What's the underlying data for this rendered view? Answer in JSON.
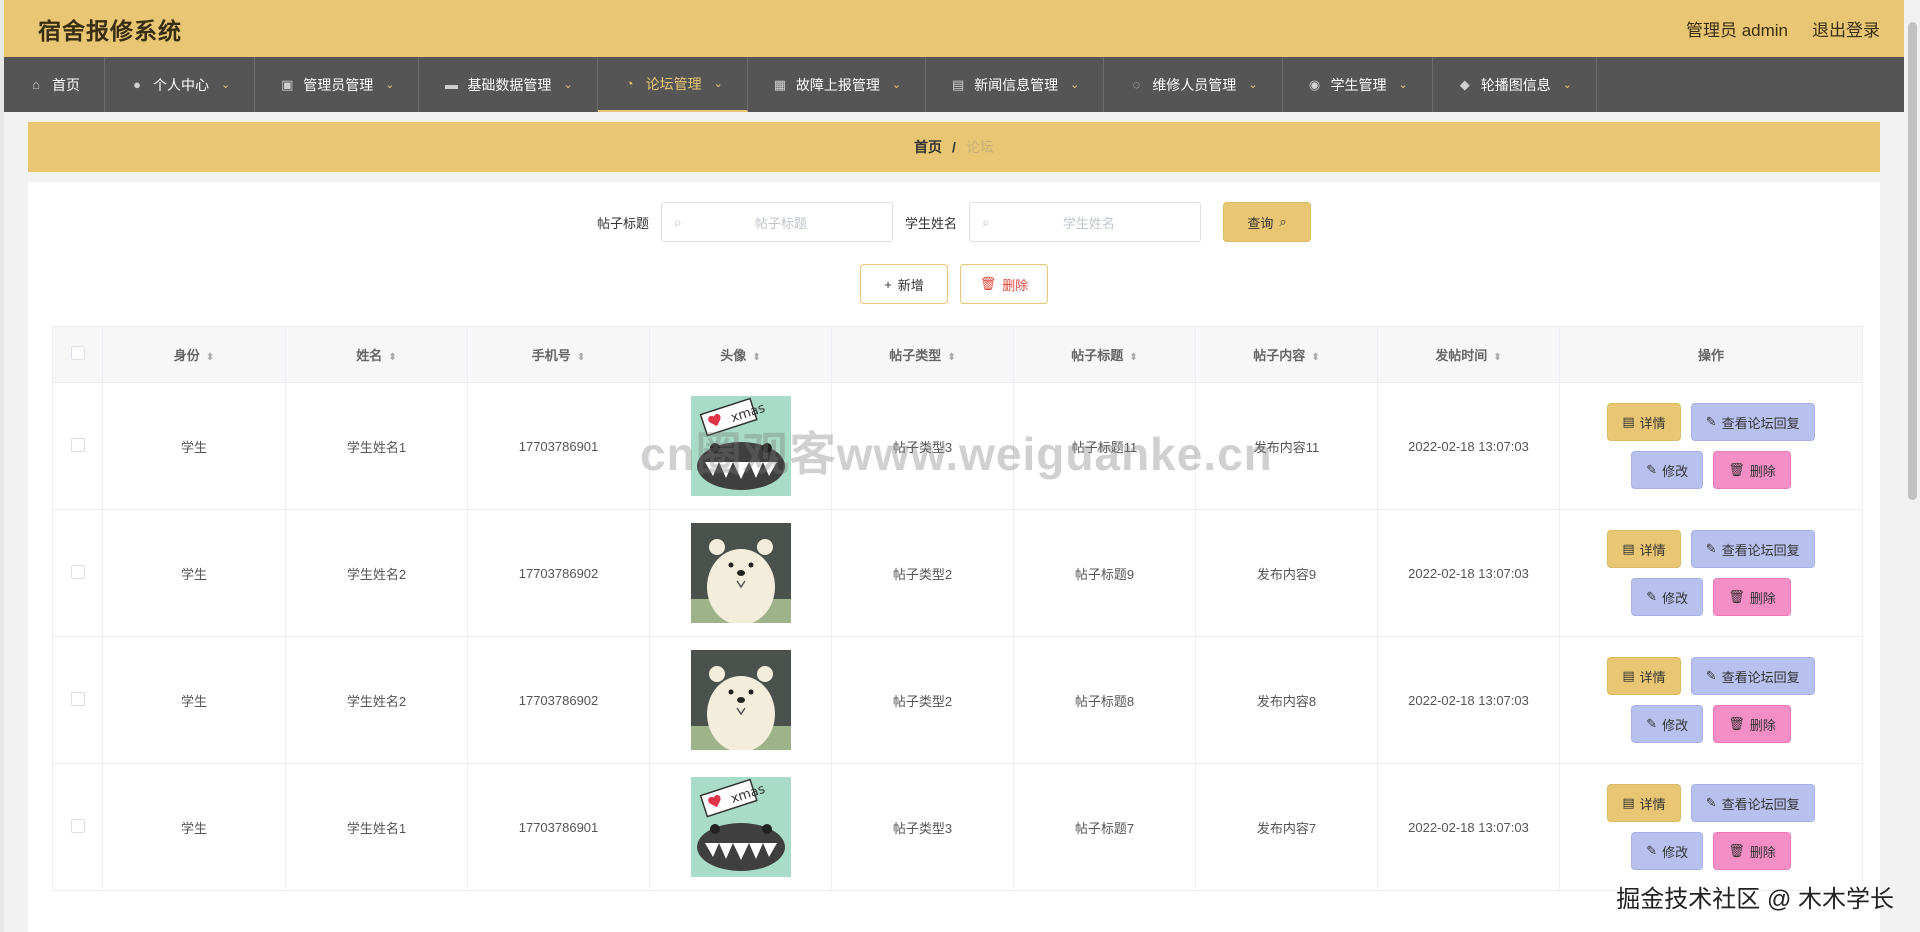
{
  "header": {
    "title": "宿舍报修系统",
    "user": "管理员 admin",
    "logout": "退出登录"
  },
  "nav": [
    {
      "label": "首页",
      "icon": "home-icon",
      "glyph": "⌂",
      "caret": false,
      "active": false
    },
    {
      "label": "个人中心",
      "icon": "user-icon",
      "glyph": "●",
      "caret": true,
      "active": false
    },
    {
      "label": "管理员管理",
      "icon": "clipboard-icon",
      "glyph": "▣",
      "caret": true,
      "active": false
    },
    {
      "label": "基础数据管理",
      "icon": "monitor-icon",
      "glyph": "▬",
      "caret": true,
      "active": false
    },
    {
      "label": "论坛管理",
      "icon": "bell-off-icon",
      "glyph": "◔",
      "caret": true,
      "active": true
    },
    {
      "label": "故障上报管理",
      "icon": "grid-icon",
      "glyph": "▦",
      "caret": true,
      "active": false
    },
    {
      "label": "新闻信息管理",
      "icon": "document-icon",
      "glyph": "▤",
      "caret": true,
      "active": false
    },
    {
      "label": "维修人员管理",
      "icon": "power-icon",
      "glyph": "◌",
      "caret": true,
      "active": false
    },
    {
      "label": "学生管理",
      "icon": "person-icon",
      "glyph": "◉",
      "caret": true,
      "active": false
    },
    {
      "label": "轮播图信息",
      "icon": "location-icon",
      "glyph": "◆",
      "caret": true,
      "active": false
    }
  ],
  "breadcrumb": {
    "home": "首页",
    "sep": "/",
    "current": "论坛"
  },
  "search": {
    "title_label": "帖子标题",
    "title_placeholder": "帖子标题",
    "name_label": "学生姓名",
    "name_placeholder": "学生姓名",
    "query_button": "查询"
  },
  "actions": {
    "add": "新增",
    "delete": "删除"
  },
  "table": {
    "headers": [
      "身份",
      "姓名",
      "手机号",
      "头像",
      "帖子类型",
      "帖子标题",
      "帖子内容",
      "发帖时间",
      "操作"
    ],
    "rows": [
      {
        "identity": "学生",
        "name": "学生姓名1",
        "phone": "17703786901",
        "avatar": "shark",
        "type": "帖子类型3",
        "title": "帖子标题11",
        "content": "发布内容11",
        "time": "2022-02-18 13:07:03"
      },
      {
        "identity": "学生",
        "name": "学生姓名2",
        "phone": "17703786902",
        "avatar": "bear",
        "type": "帖子类型2",
        "title": "帖子标题9",
        "content": "发布内容9",
        "time": "2022-02-18 13:07:03"
      },
      {
        "identity": "学生",
        "name": "学生姓名2",
        "phone": "17703786902",
        "avatar": "bear",
        "type": "帖子类型2",
        "title": "帖子标题8",
        "content": "发布内容8",
        "time": "2022-02-18 13:07:03"
      },
      {
        "identity": "学生",
        "name": "学生姓名1",
        "phone": "17703786901",
        "avatar": "shark",
        "type": "帖子类型3",
        "title": "帖子标题7",
        "content": "发布内容7",
        "time": "2022-02-18 13:07:03"
      }
    ],
    "ops": {
      "detail": "详情",
      "reply": "查看论坛回复",
      "edit": "修改",
      "delete": "删除"
    }
  },
  "avatar_text": "xmas",
  "watermark": "cn圈观客www.weiguanke.cn",
  "credit": "掘金技术社区 @ 木木学长",
  "colors": {
    "accent": "#e8c673",
    "nav": "#555555",
    "reply": "#b8c1ee",
    "delete": "#f38ec6"
  }
}
